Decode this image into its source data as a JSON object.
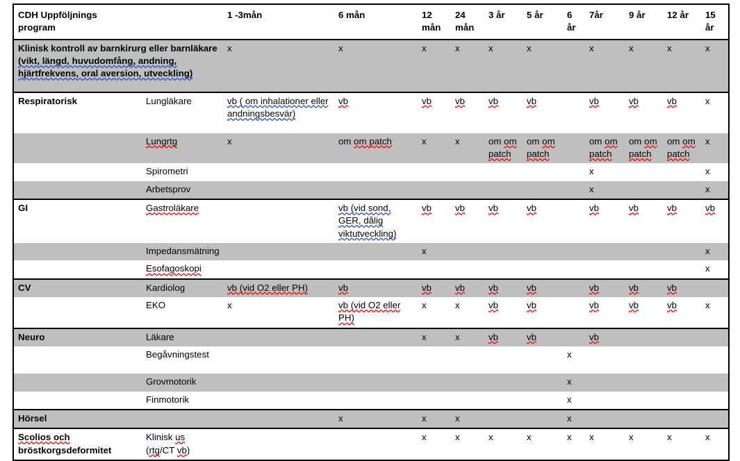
{
  "document": {
    "title": "CDH Uppföljnings program",
    "type": "clinical follow-up schedule table",
    "language": "sv"
  },
  "colors": {
    "shade_row": "#bfbfbf",
    "background": "#ffffff",
    "border": "#000000",
    "spell_error_underline": "#ff0000",
    "grammar_error_underline": "#2a4bd0"
  },
  "header": {
    "title_line1": "CDH Uppföljnings",
    "title_line2": "program",
    "columns": [
      {
        "id": "m1_3",
        "label": "1 -3mån"
      },
      {
        "id": "m6",
        "label": "6 mån"
      },
      {
        "id": "m12",
        "label_line1": "12",
        "label_line2": "mån"
      },
      {
        "id": "m24",
        "label_line1": "24",
        "label_line2": "mån"
      },
      {
        "id": "y3",
        "label": "3 år"
      },
      {
        "id": "y5",
        "label": "5 år"
      },
      {
        "id": "y6",
        "label_line1": "6",
        "label_line2": "år"
      },
      {
        "id": "y7",
        "label": "7år"
      },
      {
        "id": "y9",
        "label": "9 år"
      },
      {
        "id": "y12",
        "label": "12 år"
      },
      {
        "id": "y15",
        "label_line1": "15",
        "label_line2": "år"
      }
    ]
  },
  "rows": [
    {
      "id": "klinisk-kontroll",
      "shaded": true,
      "group_start": true,
      "category_bold": "Klinisk kontroll av barnkirurg eller barnläkare",
      "category_rest": " (vikt, längd, huvudomfång, andning, hjärtfrekvens, oral aversion, utveckling)",
      "category_spans_two": true,
      "subitem": "",
      "cells": {
        "m1_3": "x",
        "m6": "x",
        "m12": "x",
        "m24": "x",
        "y3": "x",
        "y5": "x",
        "y6": "",
        "y7": "x",
        "y9": "x",
        "y12": "x",
        "y15": "x"
      }
    },
    {
      "id": "respiratorisk-lunglakare",
      "shaded": false,
      "group_start": true,
      "category": "Respiratorisk",
      "subitem": "Lungläkare",
      "cells": {
        "m1_3": "vb ( om inhalationer eller andningsbesvär)",
        "m6": "vb",
        "m12": "vb",
        "m24": "vb",
        "y3": "vb",
        "y5": "vb",
        "y6": "",
        "y7": "vb",
        "y9": "vb",
        "y12": "vb",
        "y15": "x"
      }
    },
    {
      "id": "respiratorisk-lungrtg",
      "shaded": true,
      "category": "",
      "subitem": "Lungrtg",
      "cells": {
        "m1_3": "x",
        "m6": "om patch",
        "m12": "x",
        "m24": "x",
        "y3": "om patch",
        "y5": "om patch",
        "y6": "",
        "y7": "om patch",
        "y9": "om patch",
        "y12": "om patch",
        "y15": "x"
      }
    },
    {
      "id": "respiratorisk-spirometri",
      "shaded": false,
      "category": "",
      "subitem": "Spirometri",
      "cells": {
        "m1_3": "",
        "m6": "",
        "m12": "",
        "m24": "",
        "y3": "",
        "y5": "",
        "y6": "",
        "y7": "x",
        "y9": "",
        "y12": "",
        "y15": "x"
      }
    },
    {
      "id": "respiratorisk-arbetsprov",
      "shaded": true,
      "category": "",
      "subitem": "Arbetsprov",
      "cells": {
        "m1_3": "",
        "m6": "",
        "m12": "",
        "m24": "",
        "y3": "",
        "y5": "",
        "y6": "",
        "y7": "x",
        "y9": "",
        "y12": "",
        "y15": "x"
      }
    },
    {
      "id": "gi-gastrolakare",
      "shaded": false,
      "group_start": true,
      "category": "GI",
      "subitem": "Gastroläkare",
      "cells": {
        "m1_3": "",
        "m6": "vb (vid sond, GER, dålig viktutveckling)",
        "m12": "vb",
        "m24": "vb",
        "y3": "vb",
        "y5": "vb",
        "y6": "",
        "y7": "vb",
        "y9": "vb",
        "y12": "vb",
        "y15": "vb"
      }
    },
    {
      "id": "gi-impedansmatning",
      "shaded": true,
      "category": "",
      "subitem": "Impedansmätning",
      "cells": {
        "m1_3": "",
        "m6": "",
        "m12": "x",
        "m24": "",
        "y3": "",
        "y5": "",
        "y6": "",
        "y7": "",
        "y9": "",
        "y12": "",
        "y15": "x"
      }
    },
    {
      "id": "gi-esofagoskopi",
      "shaded": false,
      "category": "",
      "subitem": "Esofagoskopi",
      "cells": {
        "m1_3": "",
        "m6": "",
        "m12": "",
        "m24": "",
        "y3": "",
        "y5": "",
        "y6": "",
        "y7": "",
        "y9": "",
        "y12": "",
        "y15": "x"
      }
    },
    {
      "id": "cv-kardiolog",
      "shaded": true,
      "group_start": true,
      "category": "CV",
      "subitem": "Kardiolog",
      "cells": {
        "m1_3": "vb (vid O2 eller PH)",
        "m6": "vb",
        "m12": "vb",
        "m24": "vb",
        "y3": "vb",
        "y5": "vb",
        "y6": "",
        "y7": "vb",
        "y9": "vb",
        "y12": "vb",
        "y15": ""
      }
    },
    {
      "id": "cv-eko",
      "shaded": false,
      "category": "",
      "subitem": "EKO",
      "cells": {
        "m1_3": "x",
        "m6": "vb (vid O2 eller PH)",
        "m12": "x",
        "m24": "x",
        "y3": "vb",
        "y5": "vb",
        "y6": "",
        "y7": "vb",
        "y9": "vb",
        "y12": "vb",
        "y15": "x"
      }
    },
    {
      "id": "neuro-lakare",
      "shaded": true,
      "group_start": true,
      "category": "Neuro",
      "subitem": "Läkare",
      "cells": {
        "m1_3": "",
        "m6": "",
        "m12": "x",
        "m24": "x",
        "y3": "vb",
        "y5": "vb",
        "y6": "",
        "y7": "vb",
        "y9": "",
        "y12": "",
        "y15": ""
      }
    },
    {
      "id": "neuro-begavningstest",
      "shaded": false,
      "category": "",
      "subitem": "Begåvningstest",
      "cells": {
        "m1_3": "",
        "m6": "",
        "m12": "",
        "m24": "",
        "y3": "",
        "y5": "",
        "y6": "x",
        "y7": "",
        "y9": "",
        "y12": "",
        "y15": ""
      }
    },
    {
      "id": "neuro-grovmotorik",
      "shaded": true,
      "category": "",
      "subitem": "Grovmotorik",
      "cells": {
        "m1_3": "",
        "m6": "",
        "m12": "",
        "m24": "",
        "y3": "",
        "y5": "",
        "y6": "x",
        "y7": "",
        "y9": "",
        "y12": "",
        "y15": ""
      }
    },
    {
      "id": "neuro-finmotorik",
      "shaded": false,
      "category": "",
      "subitem": "Finmotorik",
      "cells": {
        "m1_3": "",
        "m6": "",
        "m12": "",
        "m24": "",
        "y3": "",
        "y5": "",
        "y6": "x",
        "y7": "",
        "y9": "",
        "y12": "",
        "y15": ""
      }
    },
    {
      "id": "horsel",
      "shaded": true,
      "group_start": true,
      "category": "Hörsel",
      "subitem": "",
      "cells": {
        "m1_3": "",
        "m6": "x",
        "m12": "x",
        "m24": "x",
        "y3": "",
        "y5": "",
        "y6": "x",
        "y7": "",
        "y9": "",
        "y12": "",
        "y15": ""
      }
    },
    {
      "id": "scolios",
      "shaded": false,
      "group_start": true,
      "category_bold_line1": "Scolios och",
      "category_bold_line2": "bröstkorgsdeformitet",
      "subitem_line1": "Klinisk us",
      "subitem_line2": "(rtg/CT vb)",
      "cells": {
        "m1_3": "",
        "m6": "",
        "m12": "x",
        "m24": "x",
        "y3": "x",
        "y5": "x",
        "y6": "x",
        "y7": "x",
        "y9": "x",
        "y12": "x",
        "y15": "x"
      }
    }
  ]
}
